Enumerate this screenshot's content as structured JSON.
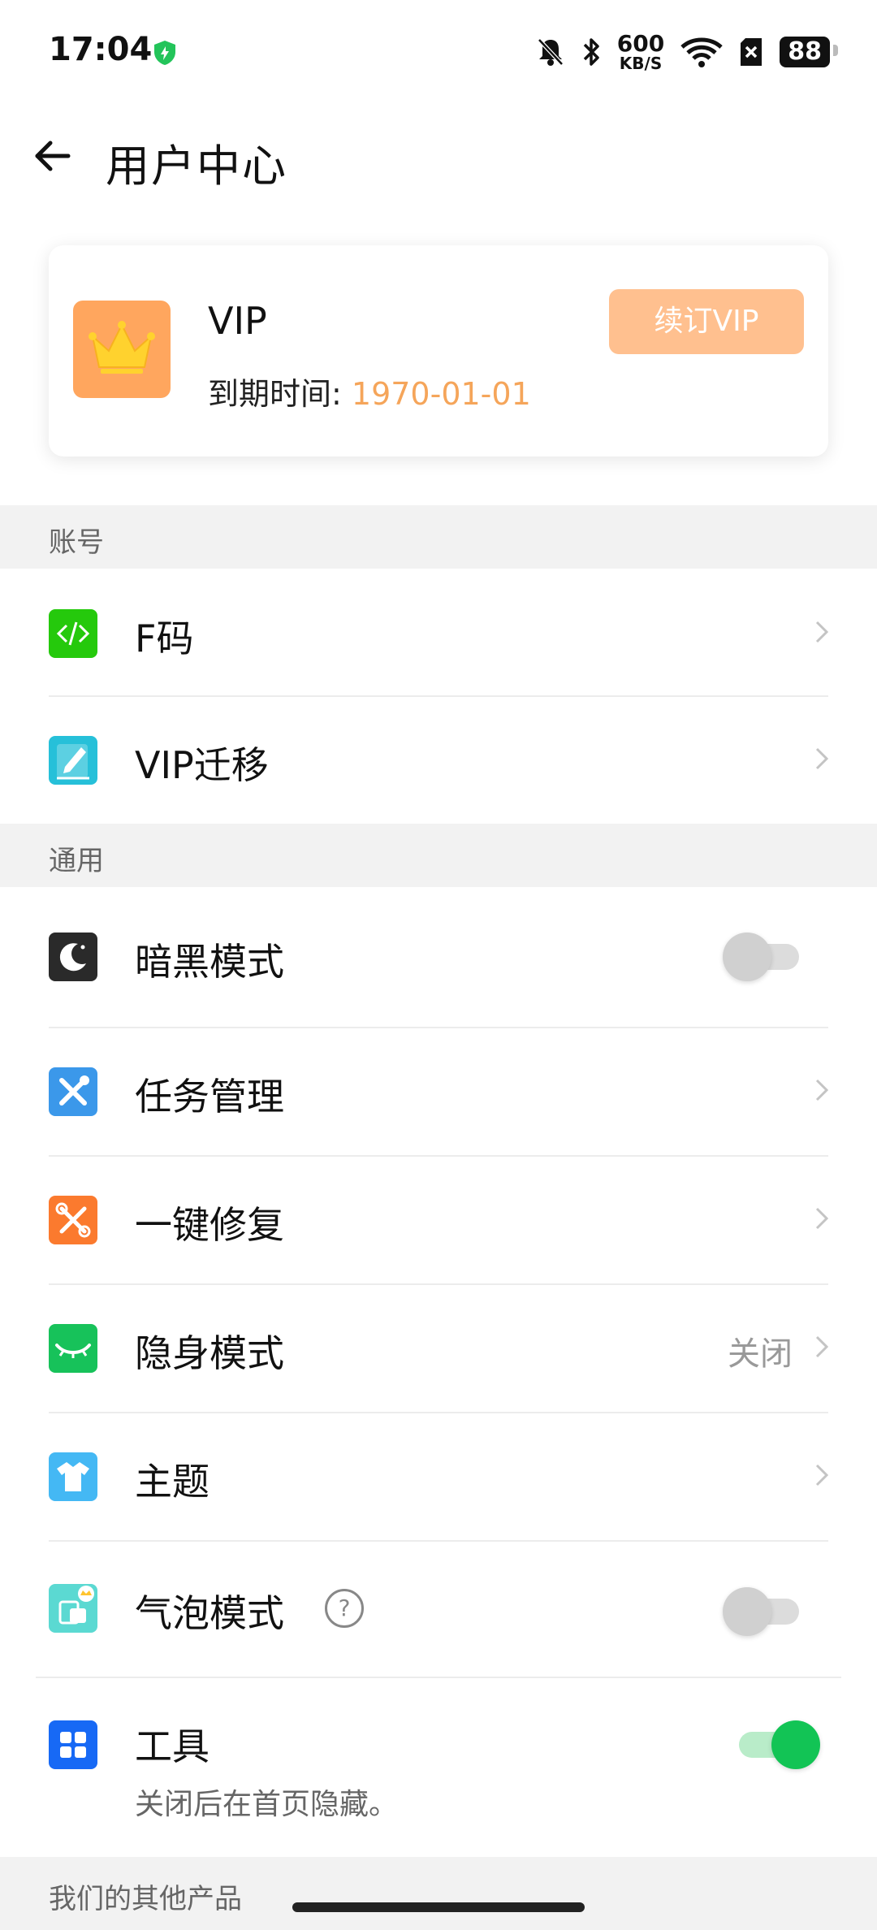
{
  "status_bar": {
    "time": "17:04",
    "net_speed_value": "600",
    "net_speed_unit": "KB/S",
    "battery": "88"
  },
  "header": {
    "title": "用户中心",
    "back_icon": "arrow-left-icon"
  },
  "vip_card": {
    "name": "VIP",
    "expiry_label": "到期时间:",
    "expiry_date": "1970-01-01",
    "renew_button": "续订VIP",
    "icon": "crown-icon"
  },
  "sections": {
    "account": {
      "title": "账号",
      "items": [
        {
          "label": "F码",
          "icon": "code-icon",
          "color": "#25c90c"
        },
        {
          "label": "VIP迁移",
          "icon": "edit-note-icon",
          "color": "#26c0d9"
        }
      ]
    },
    "general": {
      "title": "通用",
      "items": [
        {
          "label": "暗黑模式",
          "icon": "moon-icon",
          "color": "#2a2a2a",
          "toggle": "off"
        },
        {
          "label": "任务管理",
          "icon": "tools-icon",
          "color": "#3b98ea"
        },
        {
          "label": "一键修复",
          "icon": "repair-icon",
          "color": "#fb7a2e"
        },
        {
          "label": "隐身模式",
          "icon": "closed-eye-icon",
          "color": "#17c25a",
          "value": "关闭"
        },
        {
          "label": "主题",
          "icon": "shirt-icon",
          "color": "#44b8f4"
        },
        {
          "label": "气泡模式",
          "icon": "bubble-icon",
          "color": "#5bd9d2",
          "toggle": "off"
        },
        {
          "label": "工具",
          "icon": "grid-icon",
          "color": "#1769f5",
          "toggle": "on",
          "sub": "关闭后在首页隐藏。"
        }
      ]
    },
    "other": {
      "title": "我们的其他产品"
    }
  }
}
